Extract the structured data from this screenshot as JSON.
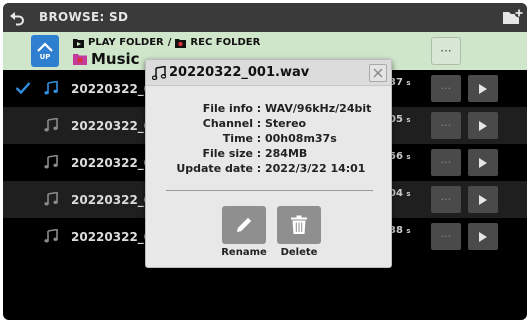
{
  "titlebar": {
    "title": "BROWSE: SD"
  },
  "folder": {
    "up_label": "UP",
    "play_folder_label": "PLAY FOLDER",
    "path_separator": "/",
    "rec_folder_label": "REC FOLDER",
    "current_folder": "Music",
    "menu_label": "···"
  },
  "files": [
    {
      "name": "20220322_0",
      "duration_main": "37",
      "duration_unit": "s",
      "selected": true
    },
    {
      "name": "20220322_0",
      "duration_main": "05",
      "duration_unit": "s",
      "selected": false
    },
    {
      "name": "20220322_0",
      "duration_main": "56",
      "duration_unit": "s",
      "selected": false
    },
    {
      "name": "20220322_0",
      "duration_main": "04",
      "duration_unit": "s",
      "selected": false
    },
    {
      "name": "20220322_0",
      "duration_main": "38",
      "duration_unit": "s",
      "selected": false
    }
  ],
  "row_menu_label": "···",
  "dialog": {
    "title": "20220322_001.wav",
    "info": [
      {
        "label": "File info",
        "value": "WAV/96kHz/24bit"
      },
      {
        "label": "Channel",
        "value": "Stereo"
      },
      {
        "label": "Time",
        "value": "00h08m37s"
      },
      {
        "label": "File size",
        "value": "284MB"
      },
      {
        "label": "Update date",
        "value": "2022/3/22 14:01"
      }
    ],
    "separator": ":",
    "rename_label": "Rename",
    "delete_label": "Delete"
  },
  "colors": {
    "up_button": "#2f7fd0",
    "check": "#2f8fe0",
    "folder_bar": "#cfe6cb",
    "rec_folder_icon": "#d9303a"
  }
}
